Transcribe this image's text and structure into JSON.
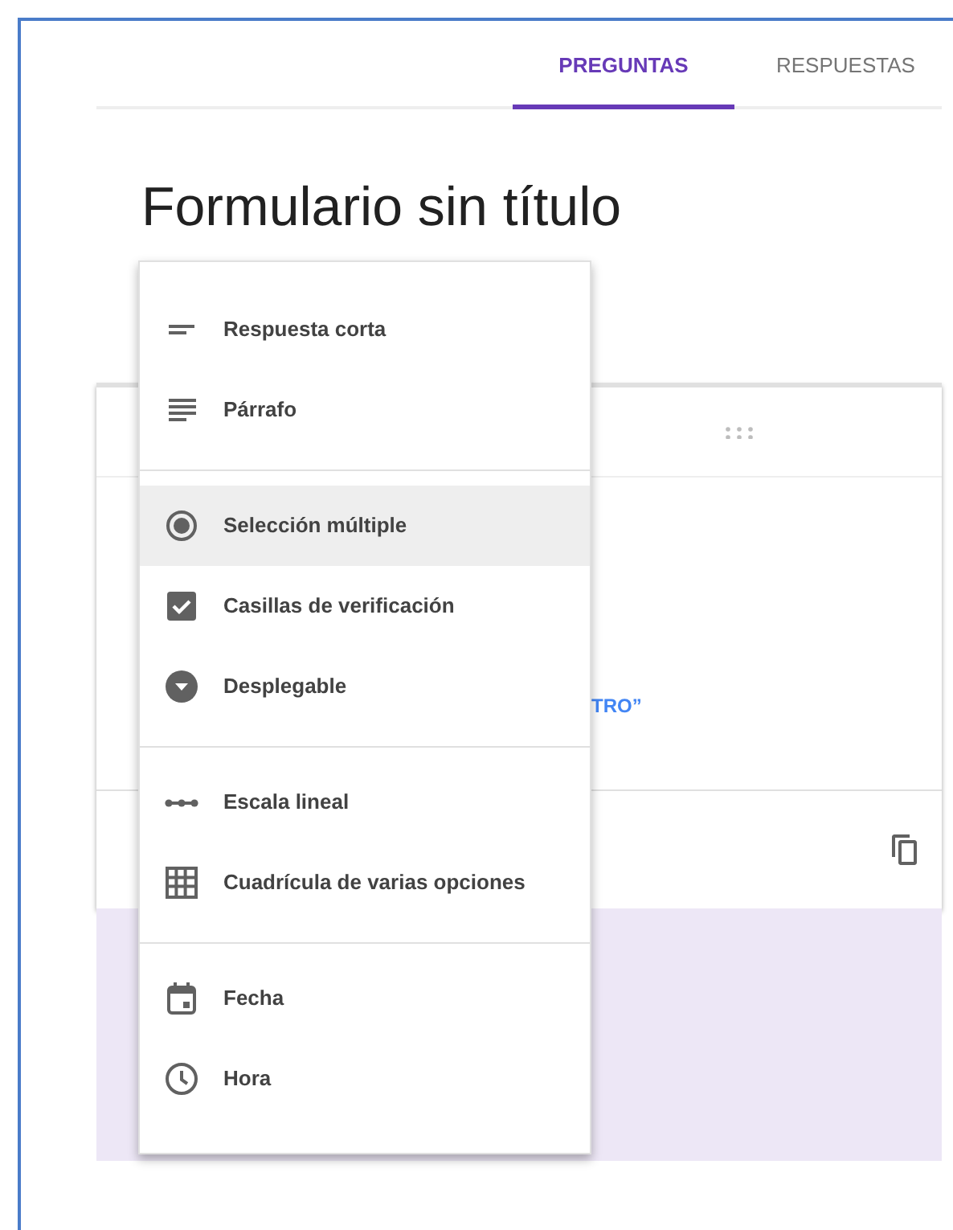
{
  "tabs": [
    {
      "label": "PREGUNTAS",
      "selected": true
    },
    {
      "label": "RESPUESTAS",
      "selected": false
    }
  ],
  "form": {
    "title": "Formulario sin título",
    "option_link": "TRO”"
  },
  "menu": {
    "groups": [
      [
        {
          "kind": "short",
          "label": "Respuesta corta",
          "selected": false
        },
        {
          "kind": "paragraph",
          "label": "Párrafo",
          "selected": false
        }
      ],
      [
        {
          "kind": "radio",
          "label": "Selección múltiple",
          "selected": true
        },
        {
          "kind": "checkbox",
          "label": "Casillas de verificación",
          "selected": false
        },
        {
          "kind": "dropdown",
          "label": "Desplegable",
          "selected": false
        }
      ],
      [
        {
          "kind": "scale",
          "label": "Escala lineal",
          "selected": false
        },
        {
          "kind": "grid",
          "label": "Cuadrícula de varias opciones",
          "selected": false
        }
      ],
      [
        {
          "kind": "date",
          "label": "Fecha",
          "selected": false
        },
        {
          "kind": "time",
          "label": "Hora",
          "selected": false
        }
      ]
    ]
  }
}
